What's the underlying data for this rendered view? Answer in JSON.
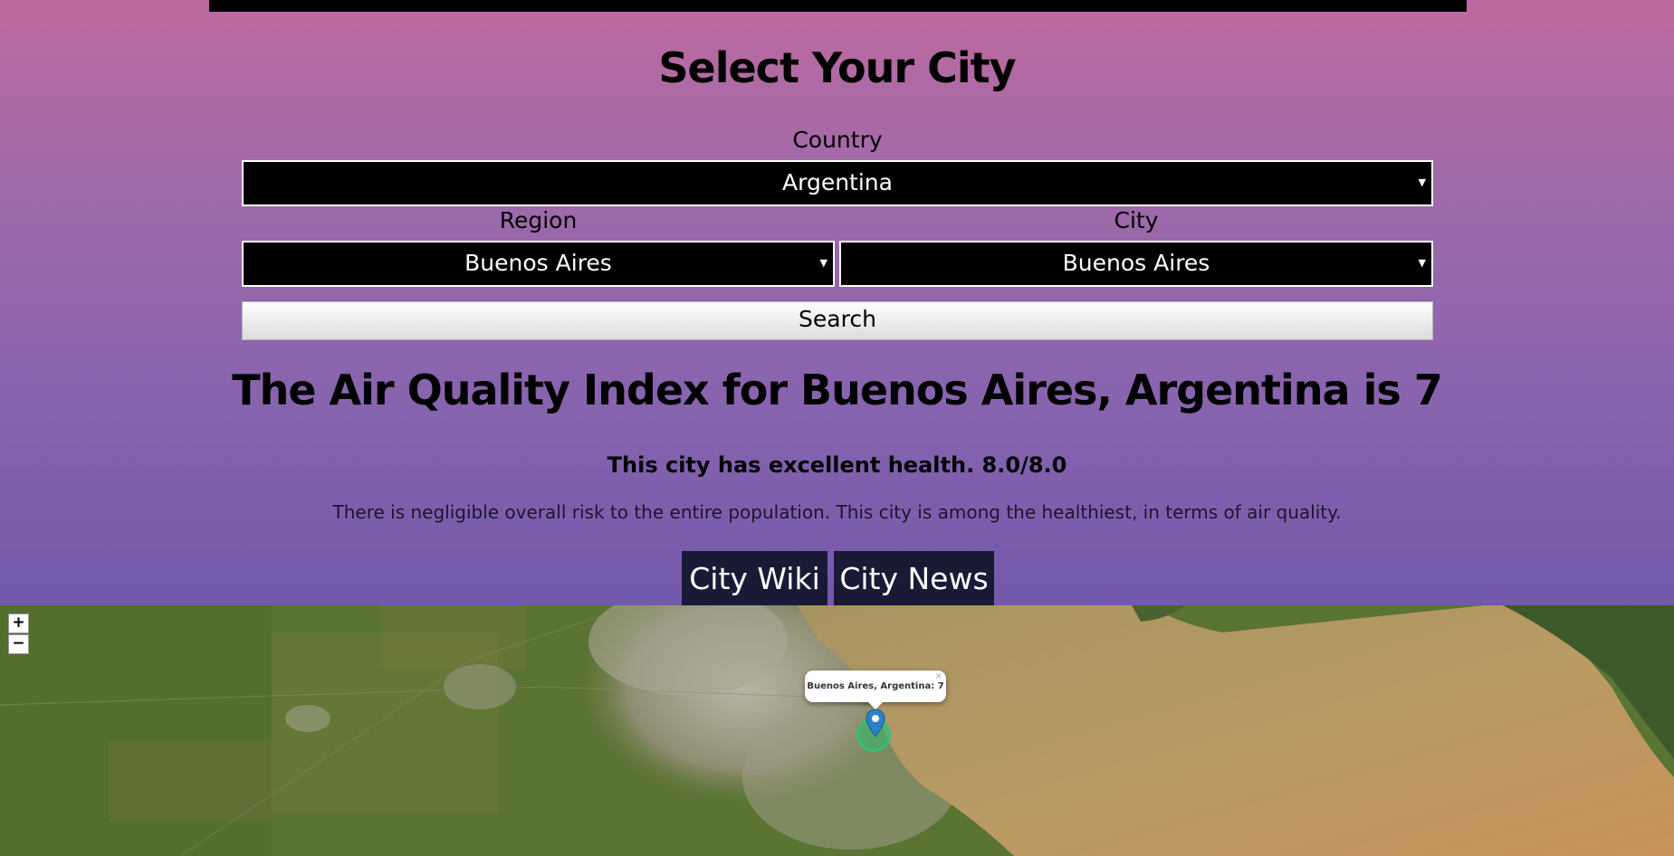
{
  "header": {
    "title": "Select Your City"
  },
  "form": {
    "country_label": "Country",
    "country_value": "Argentina",
    "region_label": "Region",
    "region_value": "Buenos Aires",
    "city_label": "City",
    "city_value": "Buenos Aires",
    "search_label": "Search"
  },
  "result": {
    "aqi_heading": "The Air Quality Index for Buenos Aires, Argentina is 7",
    "health_text": "This city has excellent health. 8.0/8.0",
    "risk_text": "There is negligible overall risk to the entire population. This city is among the healthiest, in terms of air quality."
  },
  "links": {
    "wiki_label": "City Wiki",
    "news_label": "City News"
  },
  "map": {
    "zoom_in": "+",
    "zoom_out": "−",
    "popup_text": "Buenos Aires, Argentina: 7",
    "popup_close": "×"
  },
  "icons": {
    "dropdown": "caret-down-icon",
    "marker": "map-pin-icon"
  },
  "colors": {
    "gradient_top": "#bd6a9e",
    "gradient_bottom": "#7359ac",
    "select_bg": "#000000",
    "link_button_bg": "#1a1a36",
    "aqi_marker": "#33c17a"
  }
}
